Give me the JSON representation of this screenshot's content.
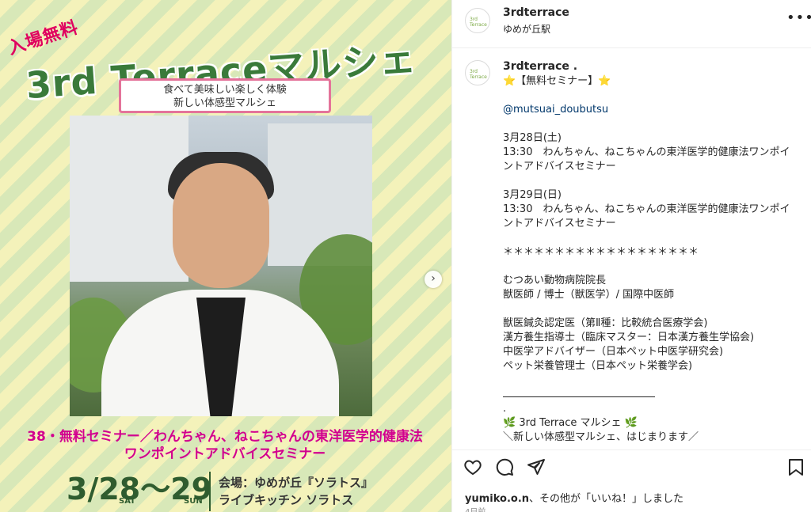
{
  "post_image": {
    "badge": "入場無料",
    "title": "3rd Terraceマルシェ",
    "subtitle_line1": "食べて美味しい楽しく体験",
    "subtitle_line2": "新しい体感型マルシェ",
    "seminar_line1": "38・無料セミナー／わんちゃん、ねこちゃんの東洋医学的健康法",
    "seminar_line2": "ワンポイントアドバイスセミナー",
    "dates": "3/28〜29",
    "day1": "SAT",
    "day2": "SUN",
    "venue_line1": "会場：ゆめが丘『ソラトス』",
    "venue_line2": "ライブキッチン ソラトス",
    "next_icon": "›"
  },
  "header": {
    "username": "3rdterrace",
    "location": "ゆめが丘駅",
    "more_icon": "•••"
  },
  "caption": {
    "username": "3rdterrace .",
    "lines": [
      "⭐️【無料セミナー】⭐️",
      "",
      "@mutsuai_doubutsu",
      "",
      "3月28日(土)",
      "13:30　わんちゃん、ねこちゃんの東洋医学的健康法ワンポイントアドバイスセミナー",
      "",
      "3月29日(日)",
      "13:30　わんちゃん、ねこちゃんの東洋医学的健康法ワンポイントアドバイスセミナー",
      "",
      "＊＊＊＊＊＊＊＊＊＊＊＊＊＊＊＊＊＊＊",
      "",
      "むつあい動物病院院長",
      "獣医師 / 博士（獣医学）/ 国際中医師",
      "",
      "獣医鍼灸認定医（第Ⅱ種：比較統合医療学会)",
      "漢方養生指導士（臨床マスター：日本漢方養生学協会)",
      "中医学アドバイザー（日本ペット中医学研究会)",
      "ペット栄養管理士（日本ペット栄養学会)",
      "",
      "",
      ".",
      "🌿 3rd Terrace マルシェ 🌿",
      "＼新しい体感型マルシェ、はじまります／"
    ]
  },
  "likes": {
    "user": "yumiko.o.n",
    "text": "、その他が「いいね！」しました"
  },
  "time_ago": "4日前",
  "colors": {
    "accent_pink": "#e0005f",
    "title_green": "#3a7a3a",
    "mention_blue": "#00376b"
  }
}
